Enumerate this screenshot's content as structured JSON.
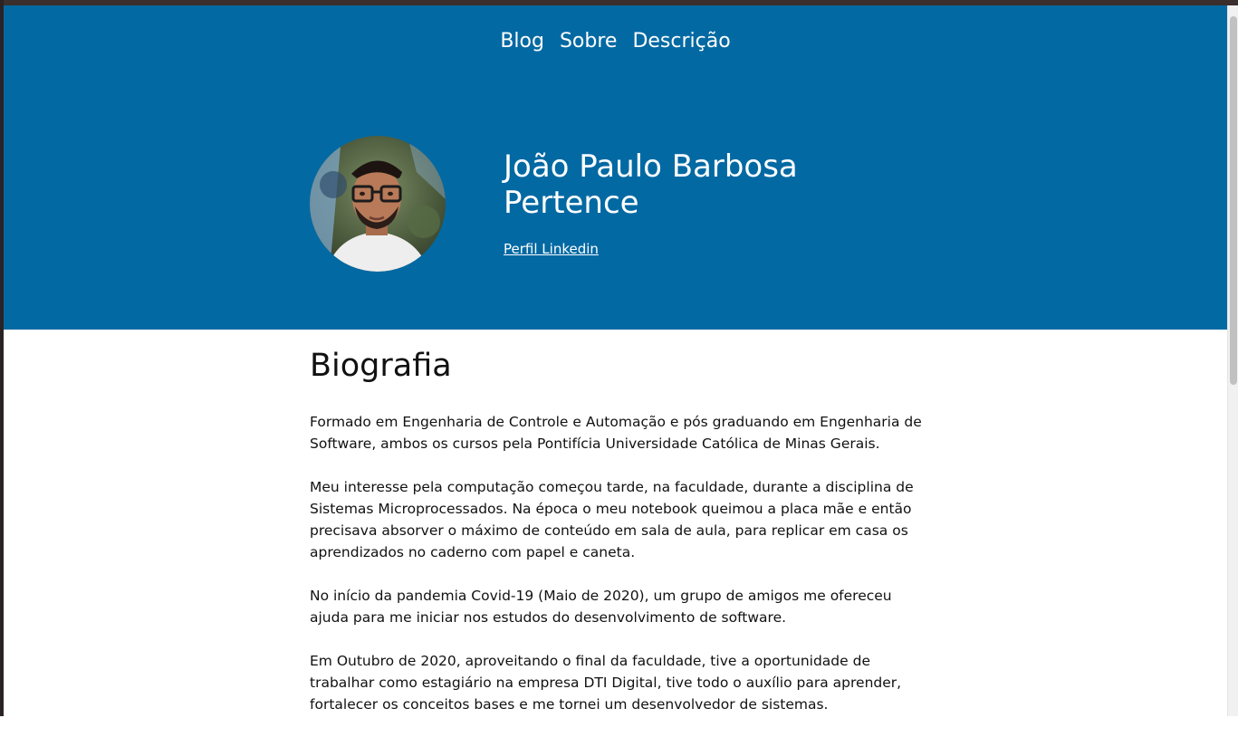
{
  "nav": {
    "items": [
      {
        "label": "Blog"
      },
      {
        "label": "Sobre"
      },
      {
        "label": "Descrição"
      }
    ]
  },
  "profile": {
    "avatar_icon": "profile-photo",
    "name": "João Paulo Barbosa Pertence",
    "linkedin_label": "Perfil Linkedin"
  },
  "bio": {
    "heading": "Biografia",
    "paragraphs": [
      "Formado em Engenharia de Controle e Automação e pós graduando em Engenharia de Software, ambos os cursos pela Pontifícia Universidade Católica de Minas Gerais.",
      "Meu interesse pela computação começou tarde, na faculdade, durante a disciplina de Sistemas Microprocessados. Na época o meu notebook queimou a placa mãe e então precisava absorver o máximo de conteúdo em sala de aula, para replicar em casa os aprendizados no caderno com papel e caneta.",
      "No início da pandemia Covid-19 (Maio de 2020), um grupo de amigos me ofereceu ajuda para me iniciar nos estudos do desenvolvimento de software.",
      "Em Outubro de 2020, aproveitando o final da faculdade, tive a oportunidade de trabalhar como estagiário na empresa DTI Digital, tive todo o auxílio para aprender, fortalecer os conceitos bases e me tornei um desenvolvedor de sistemas."
    ]
  },
  "colors": {
    "header_bg": "#0369a3",
    "text": "#111111",
    "link": "#ffffff"
  }
}
